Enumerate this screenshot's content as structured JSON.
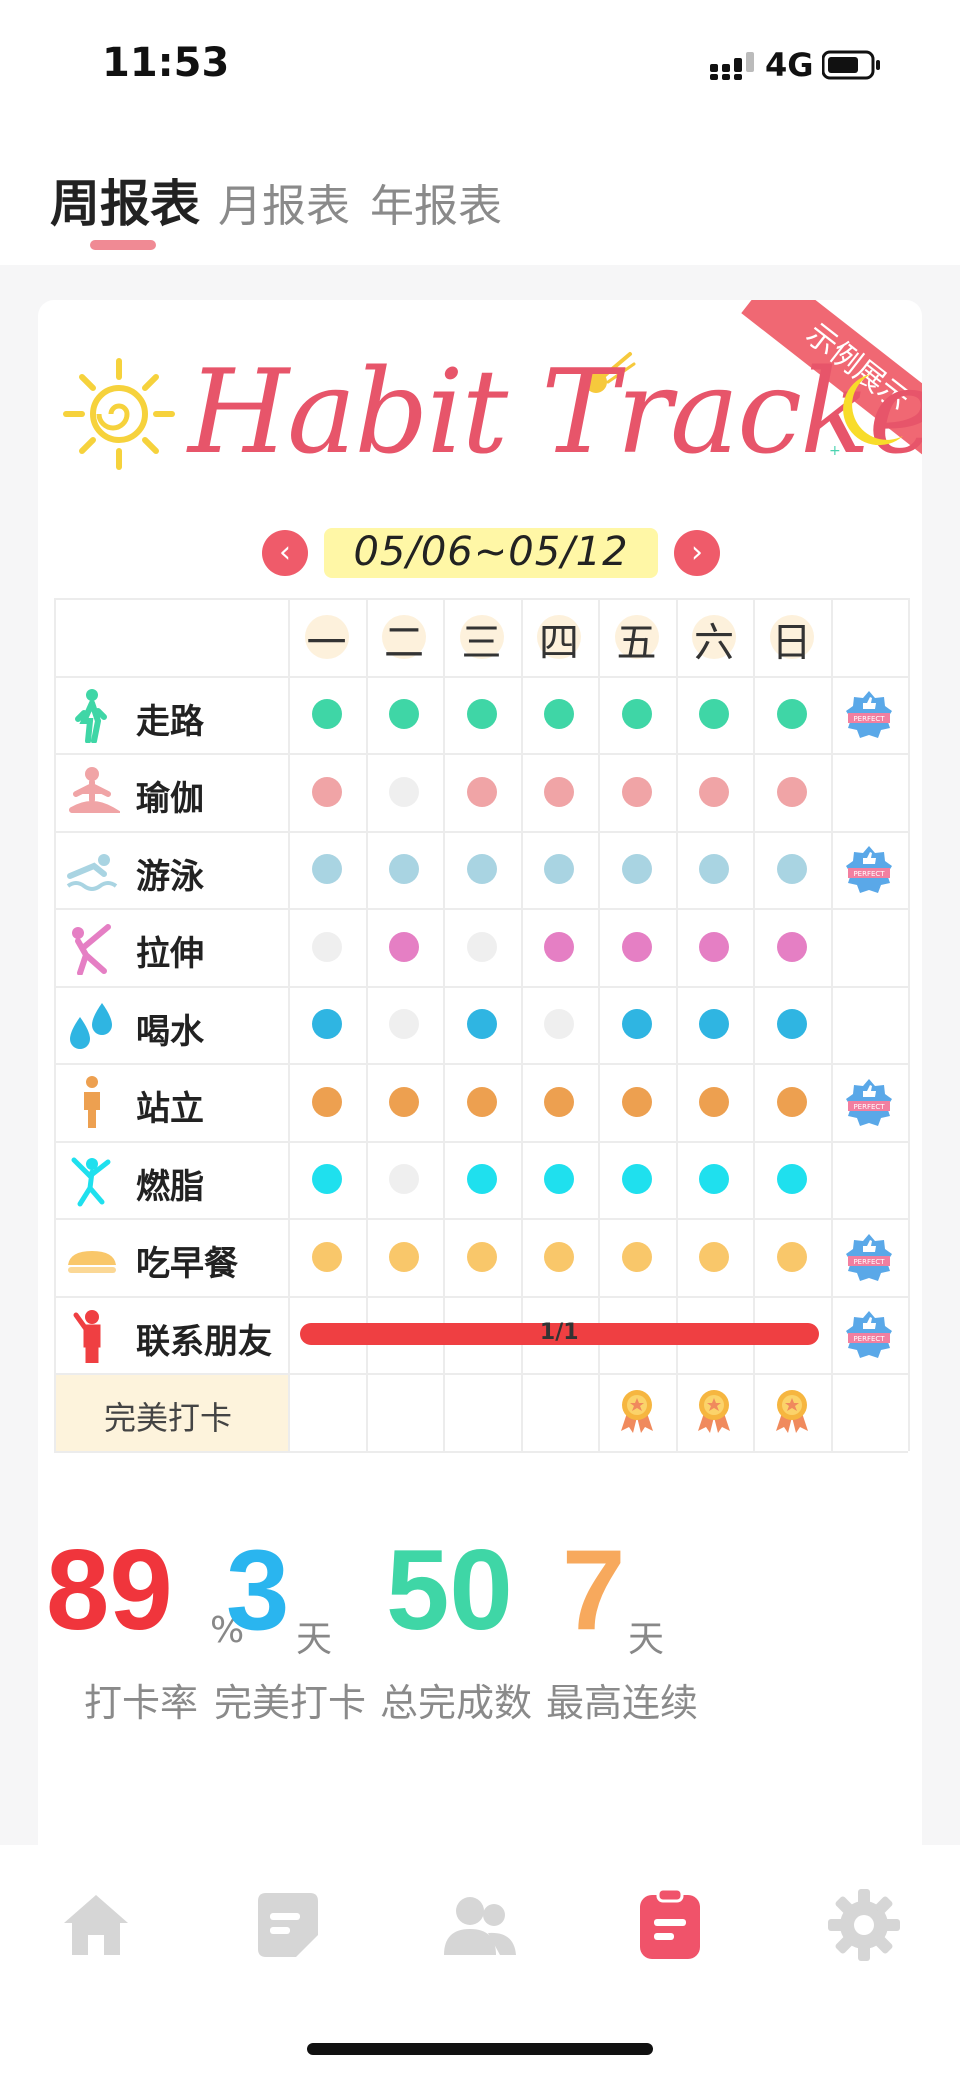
{
  "status_bar": {
    "time": "11:53",
    "network": "4G"
  },
  "tabs": [
    {
      "label": "周报表",
      "active": true
    },
    {
      "label": "月报表",
      "active": false
    },
    {
      "label": "年报表",
      "active": false
    }
  ],
  "tracker": {
    "title": "Habit Tracker",
    "sample_tag": "示例展示",
    "date_range": "05/06~05/12",
    "prev_icon": "chevron-left-icon",
    "next_icon": "chevron-right-icon",
    "days": [
      "一",
      "二",
      "三",
      "四",
      "五",
      "六",
      "日"
    ],
    "habits": [
      {
        "name": "走路",
        "icon": "walk-icon",
        "color": "#3fd6a6",
        "done": [
          1,
          1,
          1,
          1,
          1,
          1,
          1
        ],
        "perfect": true
      },
      {
        "name": "瑜伽",
        "icon": "yoga-icon",
        "color": "#f0a4a6",
        "done": [
          1,
          0,
          1,
          1,
          1,
          1,
          1
        ],
        "perfect": false
      },
      {
        "name": "游泳",
        "icon": "swim-icon",
        "color": "#a9d4e2",
        "done": [
          1,
          1,
          1,
          1,
          1,
          1,
          1
        ],
        "perfect": true
      },
      {
        "name": "拉伸",
        "icon": "stretch-icon",
        "color": "#e57fc4",
        "done": [
          0,
          1,
          0,
          1,
          1,
          1,
          1
        ],
        "perfect": false
      },
      {
        "name": "喝水",
        "icon": "water-drop-icon",
        "color": "#2fb5e2",
        "done": [
          1,
          0,
          1,
          0,
          1,
          1,
          1
        ],
        "perfect": false
      },
      {
        "name": "站立",
        "icon": "stand-icon",
        "color": "#eda050",
        "done": [
          1,
          1,
          1,
          1,
          1,
          1,
          1
        ],
        "perfect": true
      },
      {
        "name": "燃脂",
        "icon": "fat-burn-icon",
        "color": "#1fe0ee",
        "done": [
          1,
          0,
          1,
          1,
          1,
          1,
          1
        ],
        "perfect": false
      },
      {
        "name": "吃早餐",
        "icon": "bread-icon",
        "color": "#f9c76a",
        "done": [
          1,
          1,
          1,
          1,
          1,
          1,
          1
        ],
        "perfect": true
      },
      {
        "name": "联系朋友",
        "icon": "person-wave-icon",
        "color": "#ef3f42",
        "progress_text": "1/1",
        "progress": 1.0,
        "perfect": true
      }
    ],
    "perfect_row": {
      "label": "完美打卡",
      "medals": [
        0,
        0,
        0,
        0,
        1,
        1,
        1
      ]
    },
    "empty_dot_color": "#efefef"
  },
  "stats": [
    {
      "value": "89",
      "unit": "%",
      "label": "打卡率",
      "color": "#f0353c"
    },
    {
      "value": "3",
      "unit": "天",
      "label": "完美打卡",
      "color": "#2ab5ef"
    },
    {
      "value": "50",
      "unit": "",
      "label": "总完成数",
      "color": "#3fd6a6"
    },
    {
      "value": "7",
      "unit": "天",
      "label": "最高连续",
      "color": "#f7a95d"
    }
  ],
  "bottom_nav": [
    {
      "icon": "home-icon",
      "active": false
    },
    {
      "icon": "note-icon",
      "active": false
    },
    {
      "icon": "group-icon",
      "active": false
    },
    {
      "icon": "report-icon",
      "active": true
    },
    {
      "icon": "gear-icon",
      "active": false
    }
  ],
  "colors": {
    "accent": "#f0536a",
    "inactive_icon": "#d6d6d6"
  }
}
